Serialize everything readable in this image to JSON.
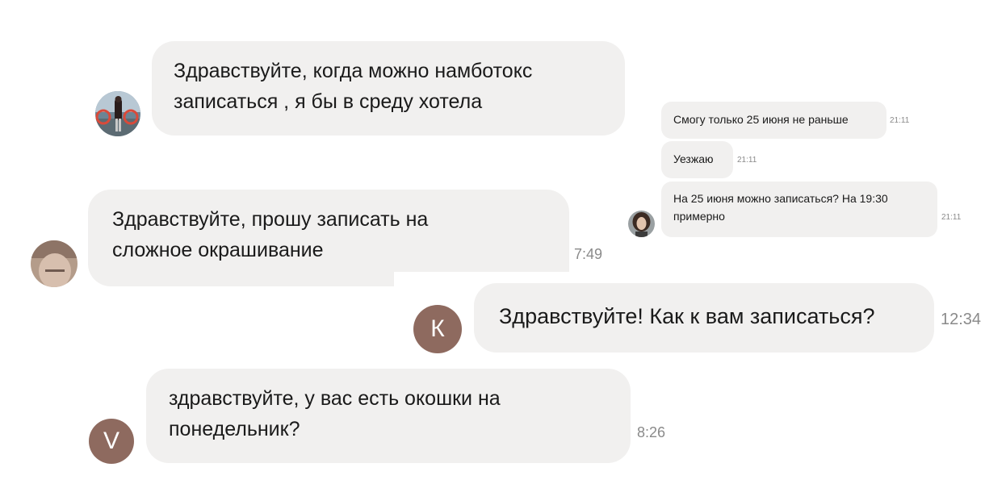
{
  "messages": [
    {
      "text_line1": "Здравствуйте, когда можно намботокс",
      "text_line2": "записаться , я бы в среду хотела",
      "avatar": "photo-avatar-woman-red"
    },
    {
      "text_line1": "Здравствуйте,  прошу записать на",
      "text_line2": "сложное окрашивание",
      "time": "7:49",
      "avatar": "photo-avatar-blurry"
    },
    {
      "text": "Здравствуйте! Как к вам записаться?",
      "time": "12:34",
      "avatar_letter": "К"
    },
    {
      "text_line1": "здравствуйте, у вас есть окошки на",
      "text_line2": "понедельник?",
      "time": "8:26",
      "avatar_letter": "V"
    }
  ],
  "thread": [
    {
      "text": "Смогу только 25 июня не раньше",
      "time": "21:11"
    },
    {
      "text": "Уезжаю",
      "time": "21:11"
    },
    {
      "text_line1": "На 25 июня можно записаться? На 19:30",
      "text_line2": "примерно",
      "time": "21:11",
      "avatar": "photo-avatar-dark-hair"
    }
  ],
  "colors": {
    "bubble": "#f1f0ef",
    "letter_avatar": "#8e6a5f",
    "time": "#8a8a8a"
  }
}
